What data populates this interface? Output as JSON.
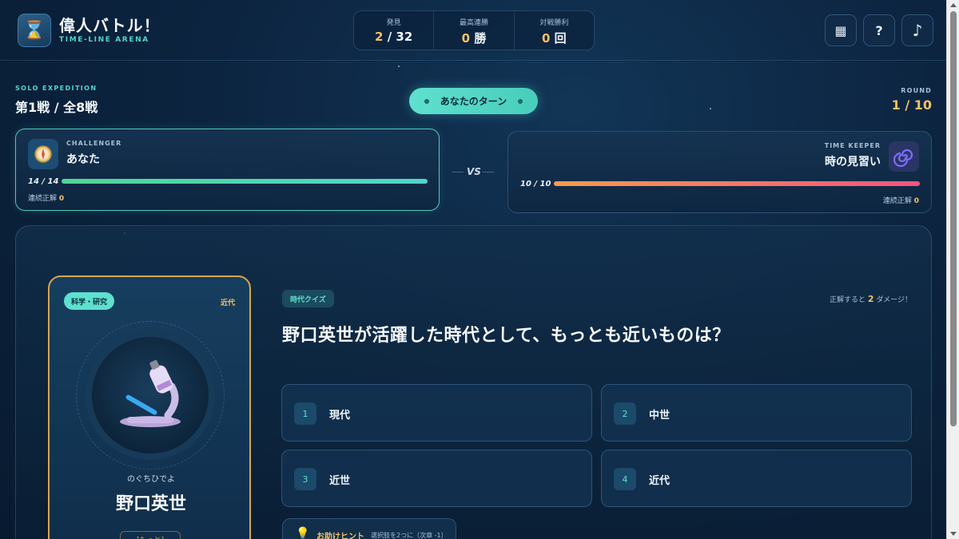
{
  "header": {
    "logo_icon": "hourglass-icon",
    "title": "偉人バトル！",
    "subtitle": "TIME-LINE ARENA",
    "stats": [
      {
        "label": "発見",
        "value": "2",
        "suffix": " / 32"
      },
      {
        "label": "最高連勝",
        "value": "0",
        "suffix": " 勝"
      },
      {
        "label": "対戦勝利",
        "value": "0",
        "suffix": " 回"
      }
    ],
    "buttons": [
      {
        "icon": "calendar-icon",
        "glyph": "▦"
      },
      {
        "icon": "help-icon",
        "glyph": "?"
      },
      {
        "icon": "music-icon",
        "glyph": "♪"
      }
    ]
  },
  "battle": {
    "mode_label": "SOLO EXPEDITION",
    "title": "第1戦 / 全8戦",
    "turn_label": "あなたのターン",
    "round_label": "ROUND",
    "round_value": "1 / 10"
  },
  "player": {
    "role": "CHALLENGER",
    "name": "あなた",
    "avatar_icon": "compass-icon",
    "hp_text": "14 / 14",
    "hp_fraction": 1.0,
    "streak_label": "連続正解",
    "streak_value": "0"
  },
  "vs_label": "VS",
  "opponent": {
    "role": "TIME KEEPER",
    "name": "時の見習い",
    "avatar_icon": "spiral-icon",
    "hp_text": "10 / 10",
    "hp_fraction": 1.0,
    "streak_label": "連続正解",
    "streak_value": "0"
  },
  "figure": {
    "category": "科学・研究",
    "era": "近代",
    "portrait_icon": "microscope-icon",
    "furigana": "のぐちひでよ",
    "name": "野口英世",
    "more_label": "[もっと]"
  },
  "quiz": {
    "tag": "時代クイズ",
    "damage_prefix": "正解すると ",
    "damage_value": "2",
    "damage_suffix": " ダメージ！",
    "question": "野口英世が活躍した時代として、もっとも近いものは？",
    "choices": [
      {
        "num": "1",
        "label": "現代"
      },
      {
        "num": "2",
        "label": "中世"
      },
      {
        "num": "3",
        "label": "近世"
      },
      {
        "num": "4",
        "label": "近代"
      }
    ],
    "hint_icon": "lightbulb-icon",
    "hint_label": "お助けヒント",
    "hint_desc": "選択肢を2つに（次章 -1）"
  },
  "colors": {
    "accent": "#5ee0cf",
    "gold": "#f3c267",
    "player_hp": "#4fd695",
    "opponent_hp": "#f0557f"
  }
}
